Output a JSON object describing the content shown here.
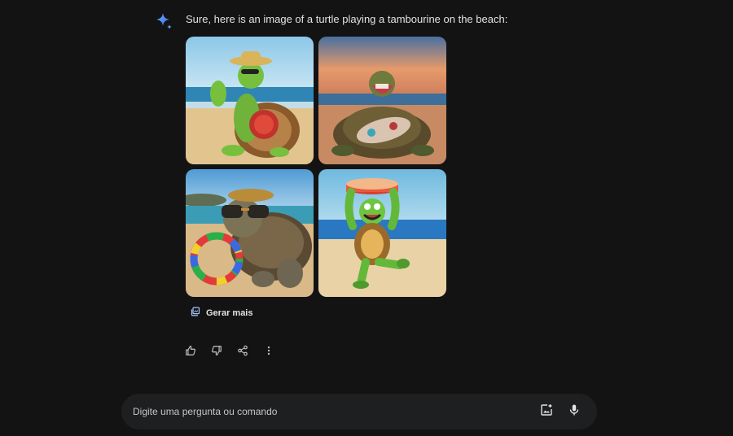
{
  "response": {
    "text": "Sure, here is an image of a turtle playing a tambourine on the beach:"
  },
  "images": [
    {
      "name": "image-1"
    },
    {
      "name": "image-2"
    },
    {
      "name": "image-3"
    },
    {
      "name": "image-4"
    }
  ],
  "generate_more_label": "Gerar mais",
  "actions": [
    "thumbs-up-icon",
    "thumbs-down-icon",
    "share-icon",
    "more-vert-icon"
  ],
  "prompt_input": {
    "placeholder": "Digite uma pergunta ou comando",
    "value": ""
  },
  "colors": {
    "background": "#131314",
    "input_bg": "#1e1f20",
    "gemini_blue": "#4a8cf7",
    "text": "#e3e3e3"
  }
}
